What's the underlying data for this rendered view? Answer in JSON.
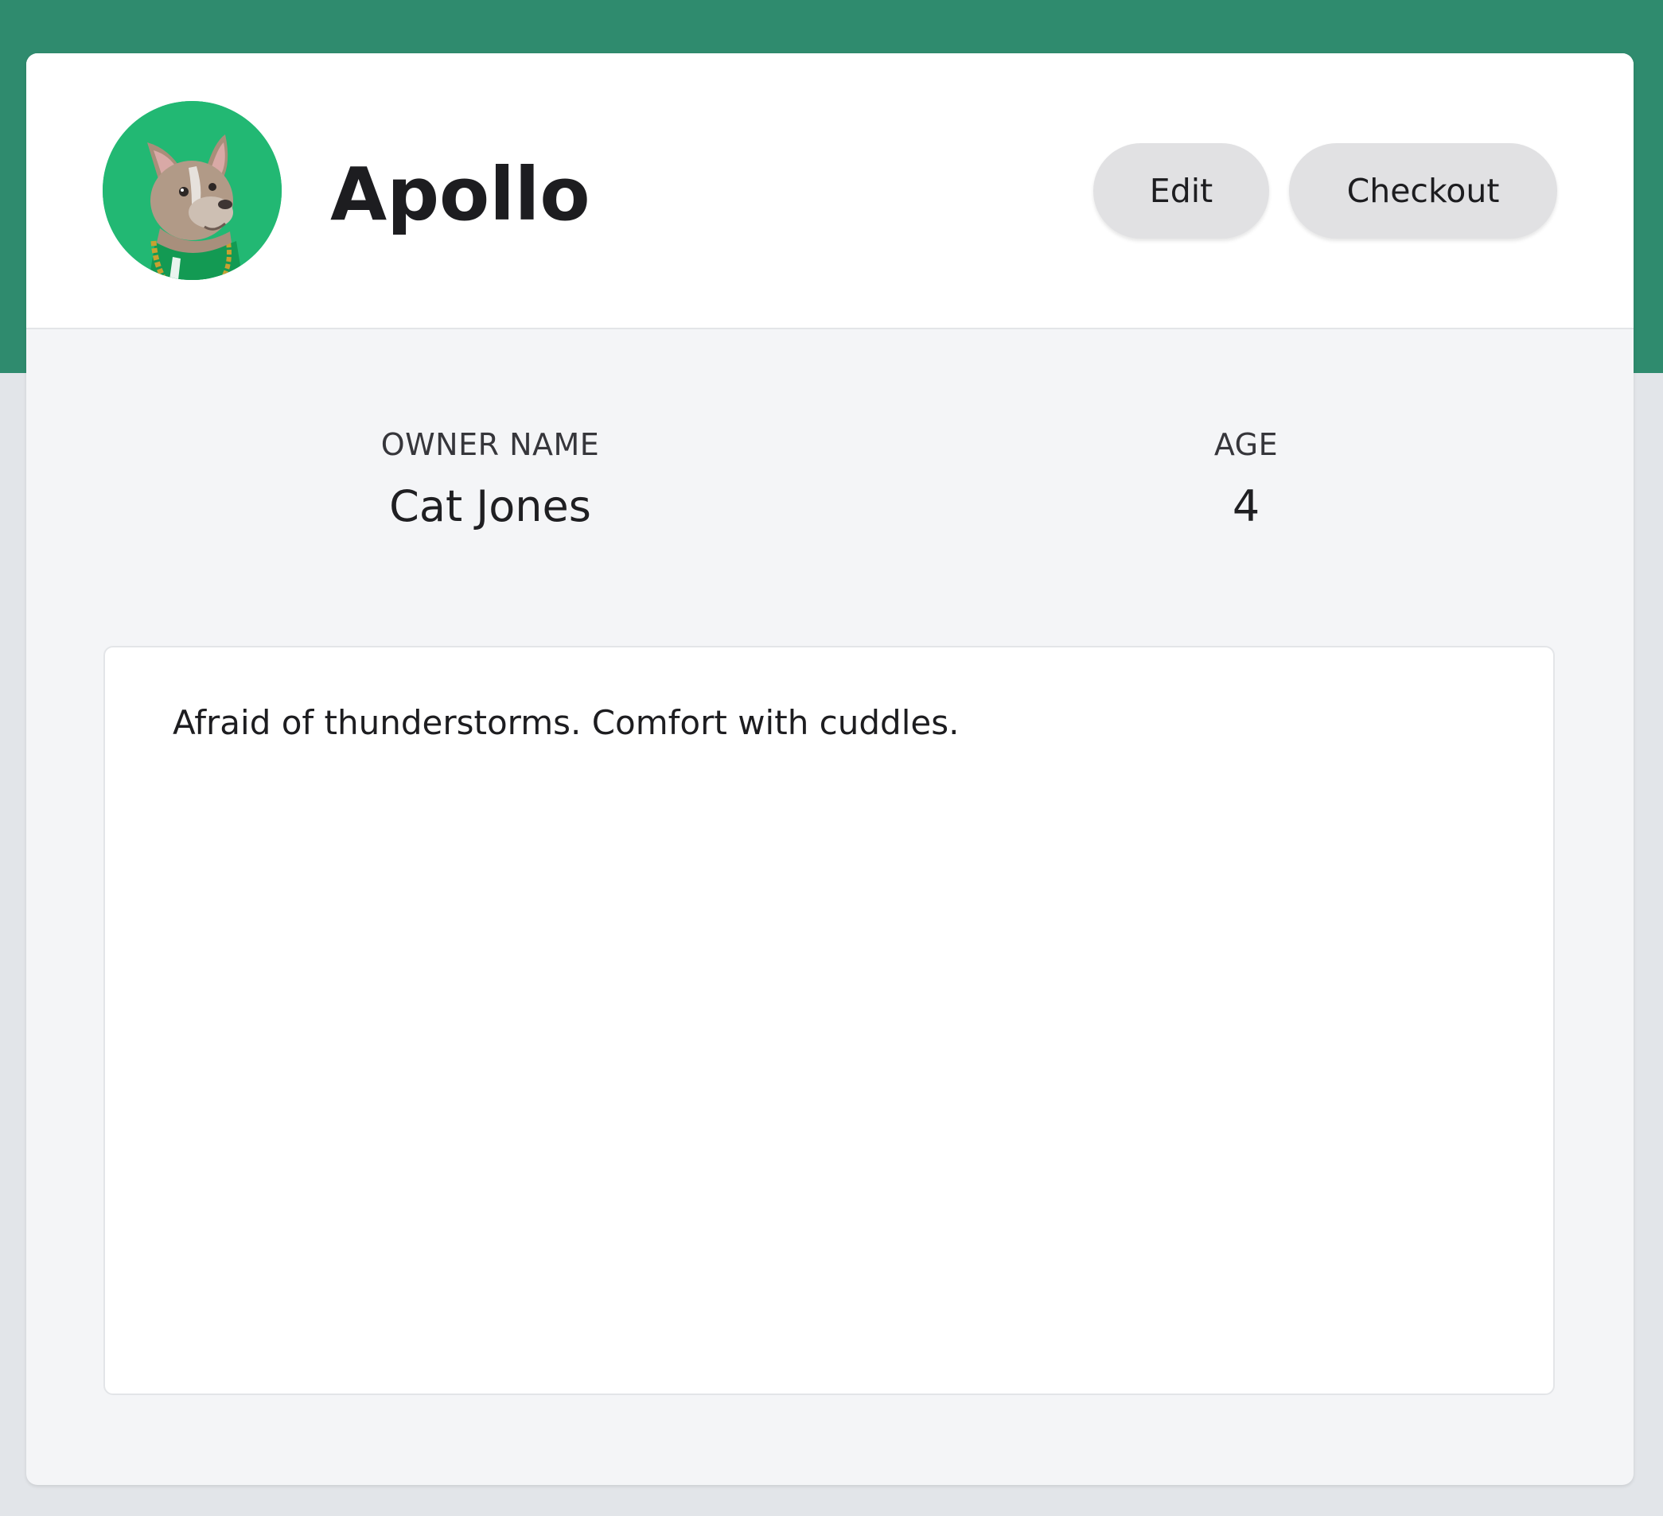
{
  "pet": {
    "name": "Apollo",
    "avatar_icon": "french-bulldog-photo"
  },
  "actions": {
    "edit_label": "Edit",
    "checkout_label": "Checkout"
  },
  "details": {
    "owner_label": "OWNER NAME",
    "owner_value": "Cat Jones",
    "age_label": "AGE",
    "age_value": "4"
  },
  "notes": {
    "text": "Afraid of thunderstorms. Comfort with cuddles."
  },
  "colors": {
    "header_band": "#2f8b6e",
    "avatar_background": "#22b873",
    "button_background": "#e1e1e3",
    "page_background": "#e2e5e9"
  }
}
